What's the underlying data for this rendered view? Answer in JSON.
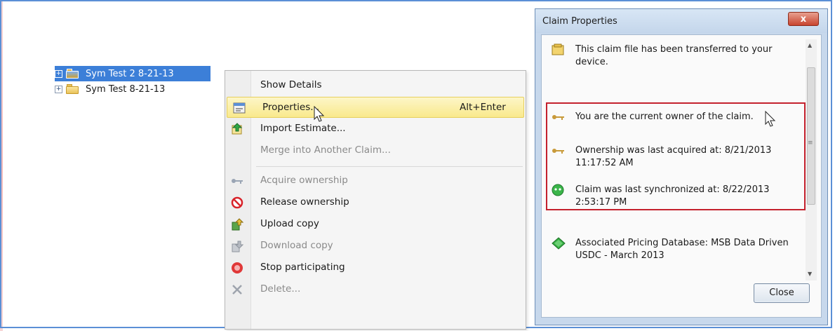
{
  "tree": {
    "items": [
      {
        "label": "Sym Test 2 8-21-13",
        "selected": true
      },
      {
        "label": "Sym Test 8-21-13",
        "selected": false
      }
    ]
  },
  "context_menu": {
    "items": [
      {
        "label": "Show Details",
        "icon": "none",
        "enabled": true
      },
      {
        "label": "Properties...",
        "shortcut": "Alt+Enter",
        "icon": "properties-icon",
        "enabled": true,
        "highlighted": true
      },
      {
        "label": "Import Estimate...",
        "icon": "import-icon",
        "enabled": true
      },
      {
        "label": "Merge into Another Claim...",
        "icon": "none",
        "enabled": false
      },
      {
        "label": "Acquire ownership",
        "icon": "key-icon",
        "enabled": false
      },
      {
        "label": "Release ownership",
        "icon": "no-entry-icon",
        "enabled": true
      },
      {
        "label": "Upload copy",
        "icon": "upload-icon",
        "enabled": true
      },
      {
        "label": "Download copy",
        "icon": "download-icon",
        "enabled": false
      },
      {
        "label": "Stop participating",
        "icon": "stop-icon",
        "enabled": true
      },
      {
        "label": "Delete...",
        "icon": "delete-icon",
        "enabled": false
      }
    ]
  },
  "dialog": {
    "title": "Claim Properties",
    "close_glyph": "x",
    "info": [
      {
        "text": "This claim file has been transferred to your device.",
        "icon": "claim-file-icon"
      },
      {
        "text": "You are the current owner of the claim.",
        "icon": "key-icon"
      },
      {
        "text": "Ownership was last acquired at: 8/21/2013 11:17:52 AM",
        "icon": "key-icon"
      },
      {
        "text": "Claim was last synchronized at: 8/22/2013 2:53:17 PM",
        "icon": "sync-icon"
      },
      {
        "text": "Associated Pricing Database: MSB Data Driven USDC - March 2013",
        "icon": "database-icon"
      }
    ],
    "close_button": "Close"
  },
  "colors": {
    "selection": "#3c7fd8",
    "menu_highlight": "#f9e98c",
    "highlight_box": "#c4212d"
  }
}
